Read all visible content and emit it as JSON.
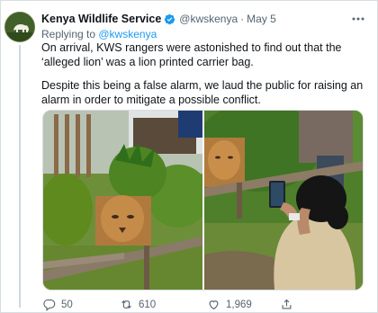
{
  "tweet": {
    "author_name": "Kenya Wildlife Service",
    "author_handle": "@kwskenya",
    "separator": "·",
    "date": "May 5",
    "replying_prefix": "Replying to ",
    "replying_to": "@kwskenya",
    "paragraph1": "On arrival, KWS rangers were astonished to find out that the ‘alleged lion’ was a lion printed carrier bag.",
    "paragraph2": "Despite this being a false alarm, we laud the public for raising an alarm in order to mitigate a possible conflict.",
    "avatar_logo_text": "KENYA WILDLIFE SERVICE"
  },
  "actions": {
    "reply_count": "50",
    "retweet_count": "610",
    "like_count": "1,969"
  },
  "colors": {
    "link": "#1d9bf0",
    "verified": "#1d9bf0",
    "secondary_text": "#536471"
  },
  "icons": [
    "verified-badge-icon",
    "more-options-icon",
    "reply-icon",
    "retweet-icon",
    "like-icon",
    "share-icon"
  ]
}
